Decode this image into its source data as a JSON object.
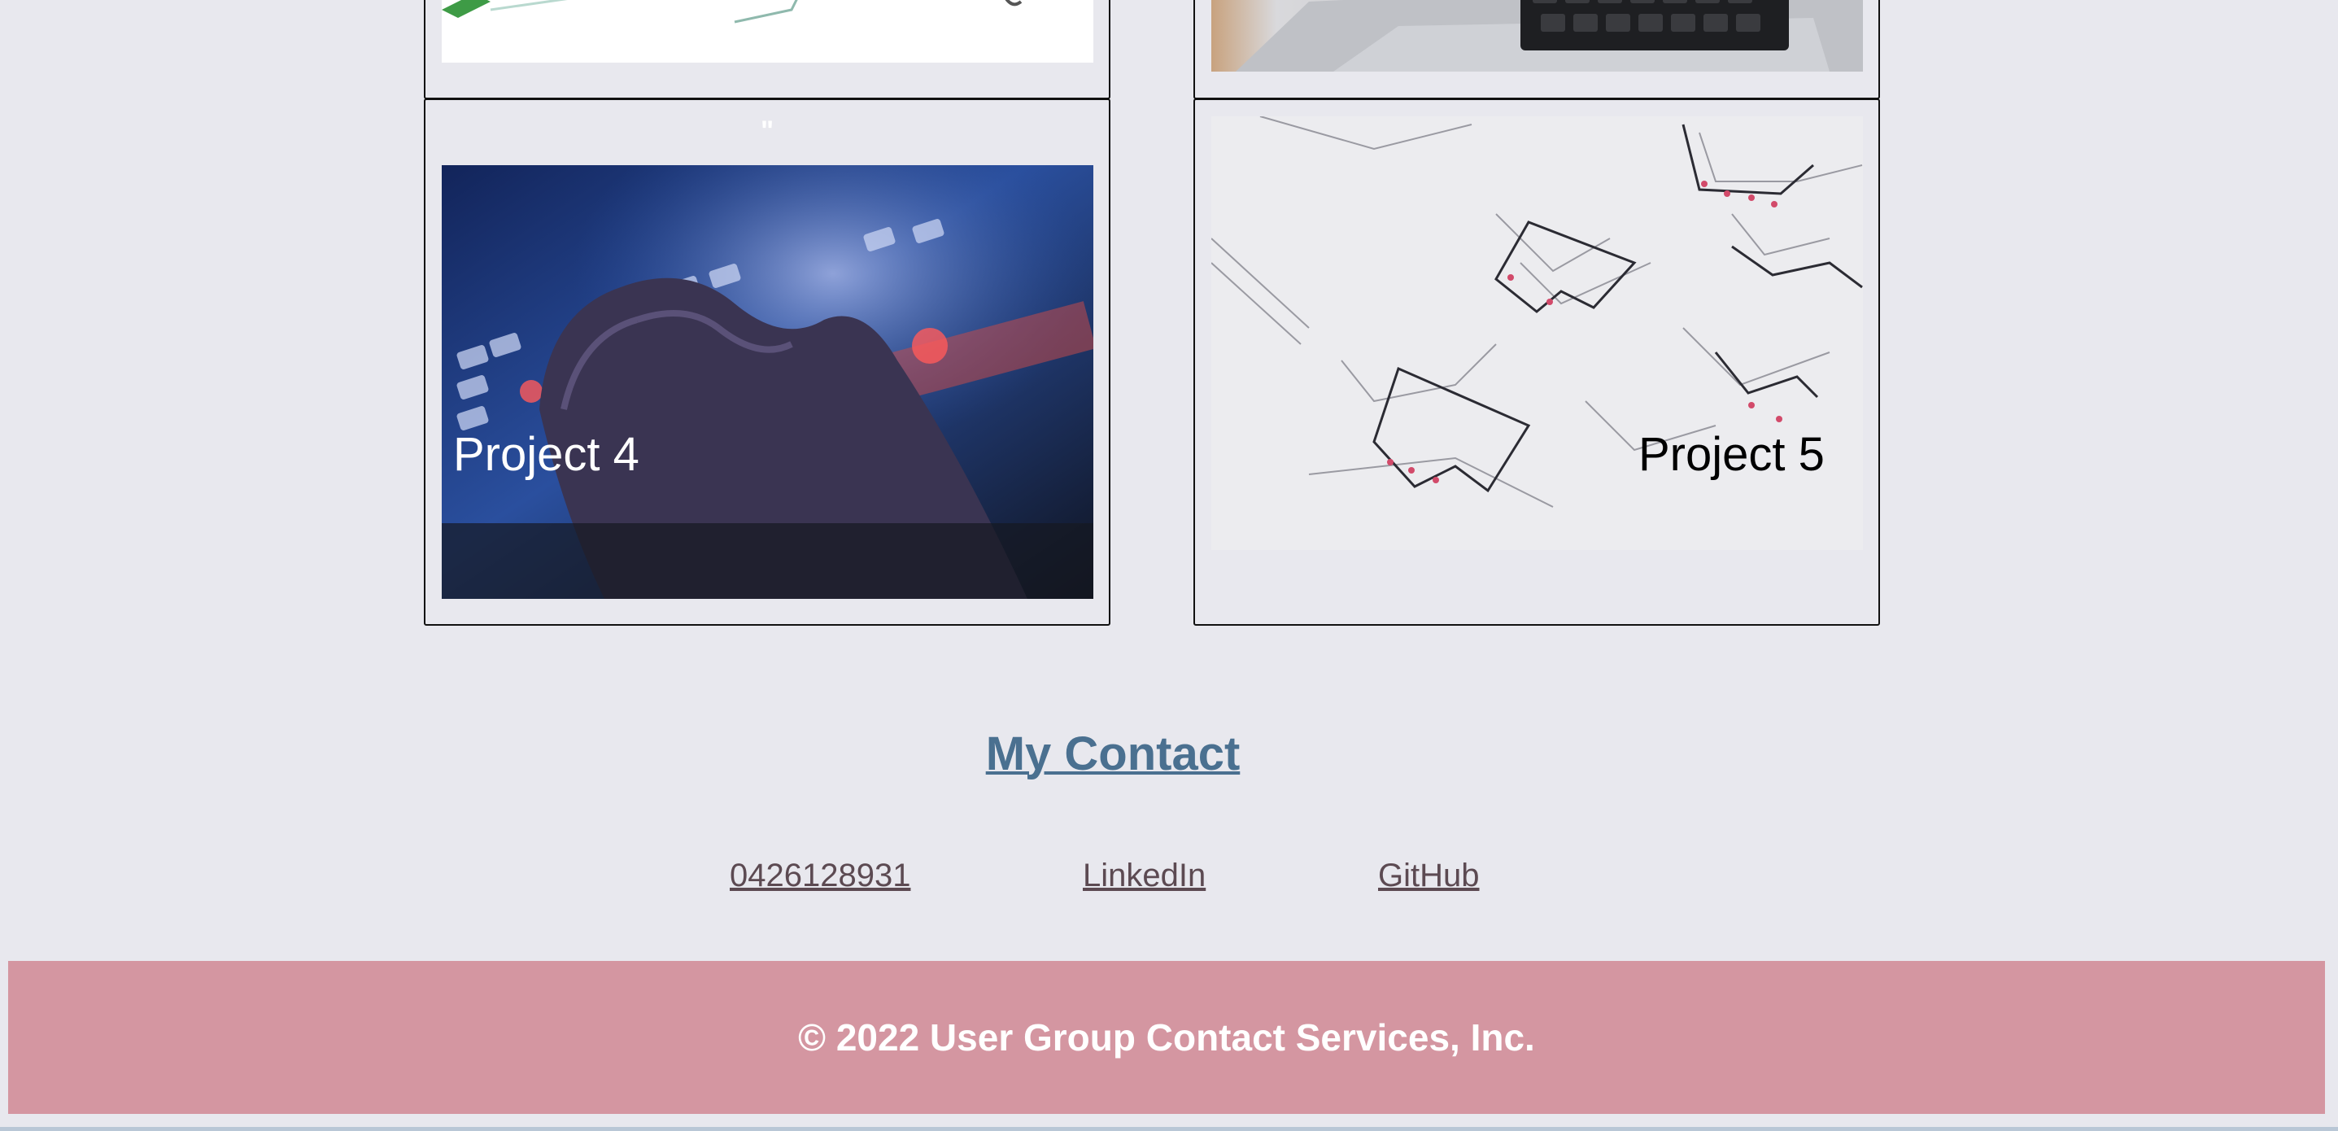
{
  "projects": {
    "card_4": {
      "label": "Project 4",
      "quote_glyph": "\"",
      "image": "hand-on-keyboard-image"
    },
    "card_5": {
      "label": "Project 5",
      "image": "blueprint-image"
    }
  },
  "contact": {
    "heading": "My Contact",
    "phone": "0426128931",
    "linkedin": "LinkedIn",
    "github": "GitHub"
  },
  "footer": {
    "copyright": "© 2022 User Group Contact Services, Inc."
  },
  "colors": {
    "page_background": "#e8e8ee",
    "heading": "#4a7090",
    "link": "#5c4a52",
    "footer_background": "#d496a1"
  }
}
